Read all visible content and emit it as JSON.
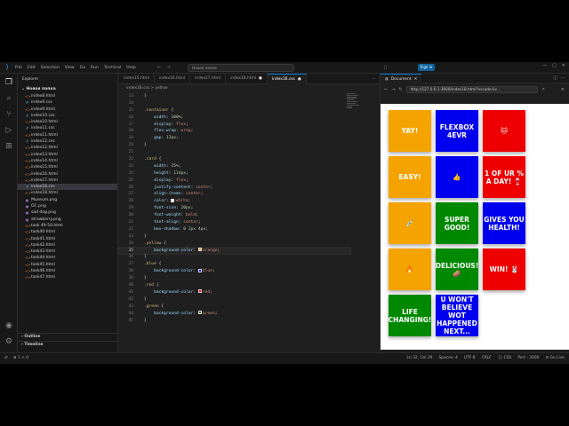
{
  "titlebar": {
    "menu": [
      "File",
      "Edit",
      "Selection",
      "View",
      "Go",
      "Run",
      "Terminal",
      "Help"
    ],
    "search": "Новая папка",
    "signin": "Sign in"
  },
  "sidebar": {
    "title": "Explorer",
    "folder": "Новая папка",
    "files": [
      {
        "name": "index8.html",
        "type": "html"
      },
      {
        "name": "index9.css",
        "type": "css"
      },
      {
        "name": "index9.html",
        "type": "html"
      },
      {
        "name": "index10.css",
        "type": "css"
      },
      {
        "name": "index10.html",
        "type": "html"
      },
      {
        "name": "index11.css",
        "type": "css"
      },
      {
        "name": "index11.html",
        "type": "html"
      },
      {
        "name": "index12.css",
        "type": "css"
      },
      {
        "name": "index12.html",
        "type": "html"
      },
      {
        "name": "index13.html",
        "type": "html"
      },
      {
        "name": "index14.html",
        "type": "html"
      },
      {
        "name": "index15.html",
        "type": "html"
      },
      {
        "name": "index16.html",
        "type": "html"
      },
      {
        "name": "index17.html",
        "type": "html"
      },
      {
        "name": "index18.css",
        "type": "css",
        "active": true
      },
      {
        "name": "index18.html",
        "type": "html"
      },
      {
        "name": "Museum.png",
        "type": "png"
      },
      {
        "name": "OC.png",
        "type": "png"
      },
      {
        "name": "sad dog.png",
        "type": "png"
      },
      {
        "name": "strawberry.png",
        "type": "png"
      },
      {
        "name": "task 49-50.html",
        "type": "html"
      },
      {
        "name": "task40.html",
        "type": "html"
      },
      {
        "name": "task41.html",
        "type": "html"
      },
      {
        "name": "task42.html",
        "type": "html"
      },
      {
        "name": "task43.html",
        "type": "html"
      },
      {
        "name": "task44.html",
        "type": "html"
      },
      {
        "name": "task45.html",
        "type": "html"
      },
      {
        "name": "task46.html",
        "type": "html"
      },
      {
        "name": "task47.html",
        "type": "html"
      }
    ],
    "outline": "Outline",
    "timeline": "Timeline"
  },
  "editor": {
    "tabs": [
      {
        "label": "index15.html",
        "active": false,
        "dirty": false
      },
      {
        "label": "index16.html",
        "active": false,
        "dirty": false
      },
      {
        "label": "index17.html",
        "active": false,
        "dirty": false
      },
      {
        "label": "index18.html",
        "active": false,
        "dirty": true
      },
      {
        "label": "index18.css",
        "active": true,
        "dirty": true
      }
    ],
    "breadcrumb": "index18.css > yellow",
    "current_line": 22,
    "lines": [
      {
        "n": 13,
        "tokens": [
          [
            "punc",
            "}"
          ]
        ]
      },
      {
        "n": 14,
        "tokens": []
      },
      {
        "n": 15,
        "tokens": [
          [
            "sel",
            ".container"
          ],
          [
            "punc",
            " {"
          ]
        ]
      },
      {
        "n": 16,
        "tokens": [
          [
            "prop",
            "    width"
          ],
          [
            "punc",
            ": "
          ],
          [
            "num",
            "100%"
          ],
          [
            "punc",
            ";"
          ]
        ]
      },
      {
        "n": 17,
        "tokens": [
          [
            "prop",
            "    display"
          ],
          [
            "punc",
            ": "
          ],
          [
            "val",
            "flex"
          ],
          [
            "punc",
            ";"
          ]
        ]
      },
      {
        "n": 18,
        "tokens": [
          [
            "prop",
            "    flex-wrap"
          ],
          [
            "punc",
            ": "
          ],
          [
            "val",
            "wrap"
          ],
          [
            "punc",
            ";"
          ]
        ]
      },
      {
        "n": 19,
        "tokens": [
          [
            "prop",
            "    gap"
          ],
          [
            "punc",
            ": "
          ],
          [
            "num",
            "12px"
          ],
          [
            "punc",
            ";"
          ]
        ]
      },
      {
        "n": 20,
        "tokens": [
          [
            "punc",
            "}"
          ]
        ]
      },
      {
        "n": 21,
        "tokens": []
      },
      {
        "n": 22,
        "tokens": [
          [
            "sel",
            ".card"
          ],
          [
            "punc",
            " {"
          ]
        ]
      },
      {
        "n": 23,
        "tokens": [
          [
            "prop",
            "    width"
          ],
          [
            "punc",
            ": "
          ],
          [
            "num",
            "25%"
          ],
          [
            "punc",
            ";"
          ]
        ]
      },
      {
        "n": 24,
        "tokens": [
          [
            "prop",
            "    height"
          ],
          [
            "punc",
            ": "
          ],
          [
            "num",
            "114px"
          ],
          [
            "punc",
            ";"
          ]
        ]
      },
      {
        "n": 25,
        "tokens": [
          [
            "prop",
            "    display"
          ],
          [
            "punc",
            ": "
          ],
          [
            "val",
            "flex"
          ],
          [
            "punc",
            ";"
          ]
        ]
      },
      {
        "n": 26,
        "tokens": [
          [
            "prop",
            "    justify-content"
          ],
          [
            "punc",
            ": "
          ],
          [
            "val",
            "center"
          ],
          [
            "punc",
            ";"
          ]
        ]
      },
      {
        "n": 27,
        "tokens": [
          [
            "prop",
            "    align-items"
          ],
          [
            "punc",
            ": "
          ],
          [
            "val",
            "center"
          ],
          [
            "punc",
            ";"
          ]
        ]
      },
      {
        "n": 28,
        "tokens": [
          [
            "prop",
            "    color"
          ],
          [
            "punc",
            ": "
          ],
          [
            "swatch",
            "#ffffff"
          ],
          [
            "val",
            "white"
          ],
          [
            "punc",
            ";"
          ]
        ]
      },
      {
        "n": 29,
        "tokens": [
          [
            "prop",
            "    font-size"
          ],
          [
            "punc",
            ": "
          ],
          [
            "num",
            "20px"
          ],
          [
            "punc",
            ";"
          ]
        ]
      },
      {
        "n": 30,
        "tokens": [
          [
            "prop",
            "    font-weight"
          ],
          [
            "punc",
            ": "
          ],
          [
            "val",
            "bold"
          ],
          [
            "punc",
            ";"
          ]
        ]
      },
      {
        "n": 31,
        "tokens": [
          [
            "prop",
            "    text-align"
          ],
          [
            "punc",
            ": "
          ],
          [
            "val",
            "center"
          ],
          [
            "punc",
            ";"
          ]
        ]
      },
      {
        "n": 32,
        "tokens": [
          [
            "prop",
            "    box-shadow"
          ],
          [
            "punc",
            ": "
          ],
          [
            "num",
            "0 2px 4px"
          ],
          [
            "punc",
            ";"
          ]
        ]
      },
      {
        "n": 33,
        "tokens": [
          [
            "punc",
            "}"
          ]
        ]
      },
      {
        "n": 34,
        "tokens": [
          [
            "sel",
            ".yellow"
          ],
          [
            "punc",
            " {"
          ]
        ]
      },
      {
        "n": 35,
        "tokens": [
          [
            "prop",
            "    background-color"
          ],
          [
            "punc",
            ": "
          ],
          [
            "swatch",
            "#ffa500"
          ],
          [
            "val",
            "orange"
          ],
          [
            "punc",
            ";"
          ]
        ]
      },
      {
        "n": 36,
        "tokens": [
          [
            "punc",
            "}"
          ]
        ]
      },
      {
        "n": 37,
        "tokens": [
          [
            "sel",
            ".blue"
          ],
          [
            "punc",
            " {"
          ]
        ]
      },
      {
        "n": 38,
        "tokens": [
          [
            "prop",
            "    background-color"
          ],
          [
            "punc",
            ": "
          ],
          [
            "swatch",
            "#0000ff"
          ],
          [
            "val",
            "blue"
          ],
          [
            "punc",
            ";"
          ]
        ]
      },
      {
        "n": 39,
        "tokens": [
          [
            "punc",
            "}"
          ]
        ]
      },
      {
        "n": 40,
        "tokens": [
          [
            "sel",
            ".red"
          ],
          [
            "punc",
            " {"
          ]
        ]
      },
      {
        "n": 41,
        "tokens": [
          [
            "prop",
            "    background-color"
          ],
          [
            "punc",
            ": "
          ],
          [
            "swatch",
            "#ff0000"
          ],
          [
            "val",
            "red"
          ],
          [
            "punc",
            ";"
          ]
        ]
      },
      {
        "n": 42,
        "tokens": [
          [
            "punc",
            "}"
          ]
        ]
      },
      {
        "n": 43,
        "tokens": [
          [
            "sel",
            ".green"
          ],
          [
            "punc",
            " {"
          ]
        ]
      },
      {
        "n": 44,
        "tokens": [
          [
            "prop",
            "    background-color"
          ],
          [
            "punc",
            ": "
          ],
          [
            "swatch",
            "#008000"
          ],
          [
            "val",
            "green"
          ],
          [
            "punc",
            ";"
          ]
        ]
      },
      {
        "n": 45,
        "tokens": [
          [
            "punc",
            "}"
          ]
        ]
      }
    ]
  },
  "preview": {
    "tab": "Document",
    "url": "http://127.0.0.1:3000/index18.html?vscode-liv...",
    "cards": [
      {
        "text": "YAY!",
        "color": "#f5a300"
      },
      {
        "text": "FLEXBOX 4EVR",
        "color": "#0000ee"
      },
      {
        "text": "🐱",
        "color": "#ee0000"
      },
      {
        "text": "EASY!",
        "color": "#f5a300"
      },
      {
        "text": "👍",
        "color": "#0000ee"
      },
      {
        "text": "1 OF UR % A DAY! 🍷",
        "color": "#ee0000"
      },
      {
        "text": "💉",
        "color": "#f5a300"
      },
      {
        "text": "SUPER GOOD!",
        "color": "#008800"
      },
      {
        "text": "GIVES YOU HEALTH!",
        "color": "#0000ee"
      },
      {
        "text": "🔥",
        "color": "#f5a300"
      },
      {
        "text": "DELICIOUS! 🥔",
        "color": "#008800"
      },
      {
        "text": "WIN! 🐰",
        "color": "#ee0000"
      },
      {
        "text": "LIFE CHANGING!",
        "color": "#008800"
      },
      {
        "text": "U WON'T BELIEVE WOT HAPPENED NEXT...",
        "color": "#0000ee"
      }
    ]
  },
  "statusbar": {
    "left": [
      "⊗ 1 ⚠ 0"
    ],
    "right": [
      "Ln 32, Col 29",
      "Spaces: 4",
      "UTF-8",
      "CRLF",
      "{} CSS",
      "Port : 3000",
      "⊘ Go Live"
    ]
  }
}
